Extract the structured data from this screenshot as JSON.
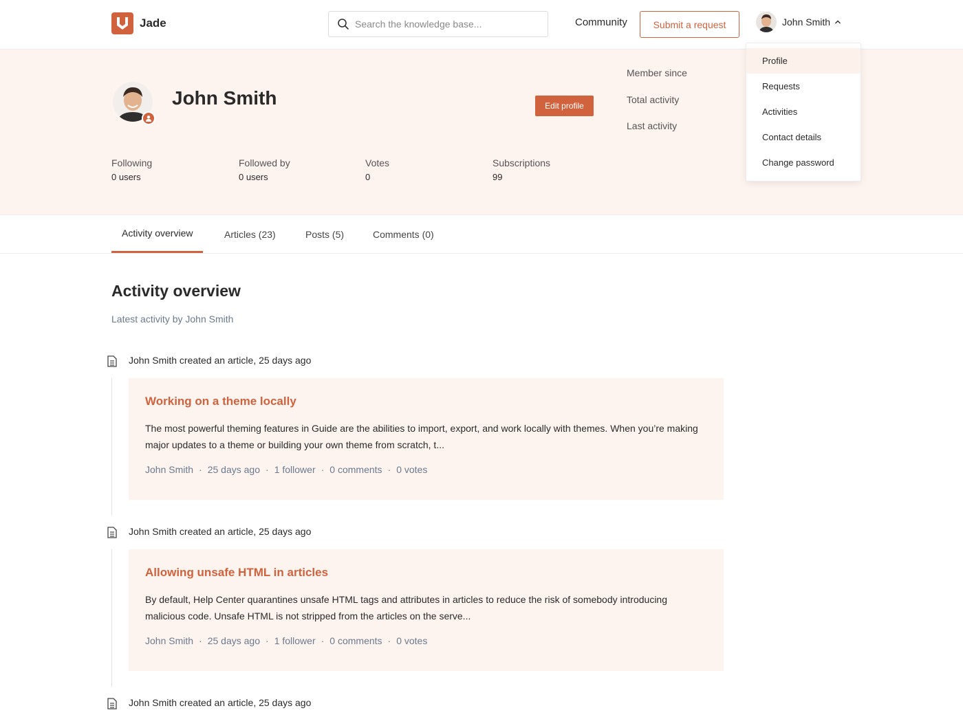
{
  "brand": {
    "name": "Jade",
    "color": "#d0623d"
  },
  "search": {
    "placeholder": "Search the knowledge base..."
  },
  "nav": {
    "community": "Community",
    "submit_request": "Submit a request"
  },
  "user": {
    "name": "John Smith"
  },
  "dropdown": {
    "items": [
      {
        "label": "Profile",
        "active": true
      },
      {
        "label": "Requests"
      },
      {
        "label": "Activities"
      },
      {
        "label": "Contact details"
      },
      {
        "label": "Change password"
      }
    ]
  },
  "profile": {
    "name": "John Smith",
    "edit_label": "Edit profile",
    "meta": [
      "Member since",
      "Total activity",
      "Last activity"
    ],
    "stats": [
      {
        "label": "Following",
        "value": "0 users"
      },
      {
        "label": "Followed by",
        "value": "0 users"
      },
      {
        "label": "Votes",
        "value": "0"
      },
      {
        "label": "Subscriptions",
        "value": "99"
      }
    ]
  },
  "tabs": [
    {
      "label": "Activity overview",
      "active": true
    },
    {
      "label": "Articles (23)"
    },
    {
      "label": "Posts (5)"
    },
    {
      "label": "Comments (0)"
    }
  ],
  "overview": {
    "title": "Activity overview",
    "subtitle": "Latest activity by John Smith"
  },
  "activities": [
    {
      "head": "John Smith created an article, 25 days ago",
      "title": "Working on a theme locally",
      "body": "The most powerful theming features in Guide are the abilities to import, export, and work locally with themes. When you’re making major updates to a theme or building your own theme from scratch, t...",
      "author": "John Smith",
      "time": "25 days ago",
      "followers": "1 follower",
      "comments": "0 comments",
      "votes": "0 votes"
    },
    {
      "head": "John Smith created an article, 25 days ago",
      "title": "Allowing unsafe HTML in articles",
      "body": "By default, Help Center quarantines unsafe HTML tags and attributes in articles to reduce the risk of somebody introducing malicious code. Unsafe HTML is not stripped from the articles on the serve...",
      "author": "John Smith",
      "time": "25 days ago",
      "followers": "1 follower",
      "comments": "0 comments",
      "votes": "0 votes"
    },
    {
      "head": "John Smith created an article, 25 days ago"
    }
  ],
  "meta_separator": "·"
}
